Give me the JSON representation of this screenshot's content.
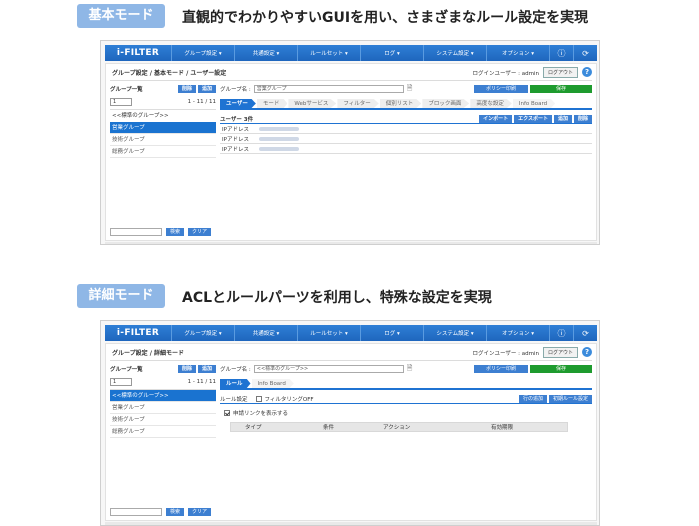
{
  "sections": [
    {
      "mode_label": "基本モード",
      "mode_desc": "直観的でわかりやすいGUIを用い、さまざまなルール設定を実現",
      "app": {
        "logo": "i-FILTER",
        "menu": [
          "グループ設定 ▾",
          "共通設定 ▾",
          "ルールセット ▾",
          "ログ ▾",
          "システム設定 ▾",
          "オプション ▾"
        ],
        "breadcrumb": "グループ設定 / 基本モード / ユーザー設定",
        "login_user": "ログインユーザー : admin",
        "logout": "ログアウト",
        "group_list_label": "グループ一覧",
        "btn_delete": "削除",
        "btn_add": "追加",
        "select_value": "1",
        "paging": "1 - 11 / 11",
        "groups": [
          "<<標準のグループ>>",
          "営業グループ",
          "技術グループ",
          "総務グループ"
        ],
        "active_group": 1,
        "btn_search": "検索",
        "btn_clear": "クリア",
        "group_name_label": "グループ名 :",
        "group_name_value": "営業グループ",
        "btn_policy": "ポリシー印刷",
        "btn_save": "保存",
        "tabs": [
          "ユーザー",
          "モード",
          "Webサービス",
          "フィルター",
          "個別リスト",
          "ブロック画面",
          "高度な設定",
          "Info Board"
        ],
        "user_count": "ユーザー 3件",
        "btn_import": "インポート",
        "btn_export": "エクスポート",
        "btn_add2": "追加",
        "btn_delete2": "削除",
        "ip_label": "IPアドレス"
      }
    },
    {
      "mode_label": "詳細モード",
      "mode_desc": "ACLとルールパーツを利用し、特殊な設定を実現",
      "app": {
        "logo": "i-FILTER",
        "menu": [
          "グループ設定 ▾",
          "共通設定 ▾",
          "ルールセット ▾",
          "ログ ▾",
          "システム設定 ▾",
          "オプション ▾"
        ],
        "breadcrumb": "グループ設定 / 詳細モード",
        "login_user": "ログインユーザー : admin",
        "logout": "ログアウト",
        "group_list_label": "グループ一覧",
        "btn_delete": "削除",
        "btn_add": "追加",
        "select_value": "1",
        "paging": "1 - 11 / 11",
        "groups": [
          "<<標準のグループ>>",
          "営業グループ",
          "技術グループ",
          "総務グループ"
        ],
        "active_group": 0,
        "btn_search": "検索",
        "btn_clear": "クリア",
        "group_name_label": "グループ名 :",
        "group_name_value": "<<標準のグループ>>",
        "btn_policy": "ポリシー印刷",
        "btn_save": "保存",
        "tabs": [
          "ルール",
          "Info Board"
        ],
        "rule_setting": "ルール設定",
        "filtering_off": "フィルタリングOFF",
        "btn_add_row": "行の追加",
        "btn_initial_rule": "初期ルール設定",
        "show_link": "申請リンクを表示する",
        "table_headers": [
          "タイプ",
          "条件",
          "アクション",
          "有効期限"
        ]
      }
    }
  ],
  "colors": {
    "pill": "#8fb7e6",
    "topbar": "#1f66bd",
    "active": "#1a73d0",
    "save": "#1e9b2e"
  }
}
